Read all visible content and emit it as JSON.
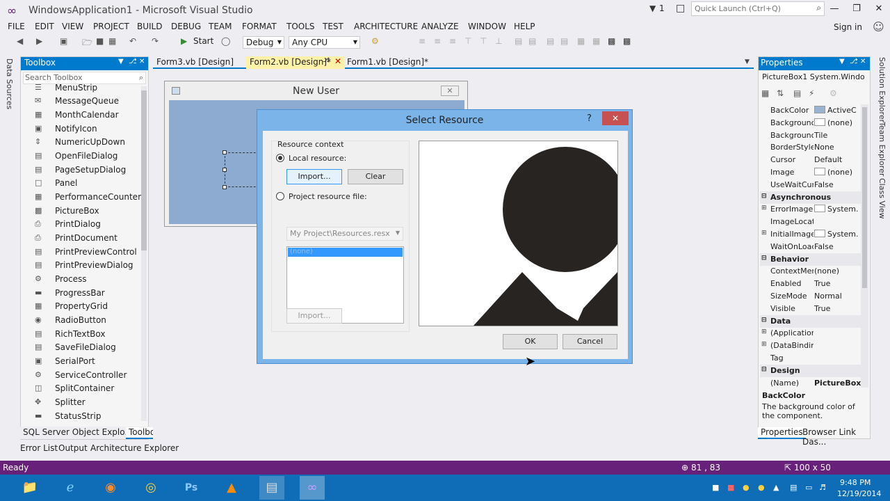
{
  "window": {
    "title": "WindowsApplication1 - Microsoft Visual Studio",
    "notif_count": "1",
    "quick_launch_placeholder": "Quick Launch (Ctrl+Q)",
    "sign_in": "Sign in"
  },
  "menu": [
    "FILE",
    "EDIT",
    "VIEW",
    "PROJECT",
    "BUILD",
    "DEBUG",
    "TEAM",
    "FORMAT",
    "TOOLS",
    "TEST",
    "ARCHITECTURE",
    "ANALYZE",
    "WINDOW",
    "HELP"
  ],
  "toolbar": {
    "start_label": "Start",
    "config": "Debug",
    "platform": "Any CPU"
  },
  "left_vertical_tabs": [
    "Data Sources"
  ],
  "toolbox": {
    "title": "Toolbox",
    "search_placeholder": "Search Toolbox",
    "items": [
      "MenuStrip",
      "MessageQueue",
      "MonthCalendar",
      "NotifyIcon",
      "NumericUpDown",
      "OpenFileDialog",
      "PageSetupDialog",
      "Panel",
      "PerformanceCounter",
      "PictureBox",
      "PrintDialog",
      "PrintDocument",
      "PrintPreviewControl",
      "PrintPreviewDialog",
      "Process",
      "ProgressBar",
      "PropertyGrid",
      "RadioButton",
      "RichTextBox",
      "SaveFileDialog",
      "SerialPort",
      "ServiceController",
      "SplitContainer",
      "Splitter",
      "StatusStrip"
    ],
    "tabs": [
      "SQL Server Object Explo...",
      "Toolbox"
    ]
  },
  "document_tabs": [
    {
      "label": "Form3.vb [Design]",
      "active": false
    },
    {
      "label": "Form2.vb [Design]*",
      "active": true
    },
    {
      "label": "Form1.vb [Design]*",
      "active": false
    }
  ],
  "form": {
    "title": "New User"
  },
  "dialog": {
    "title": "Select Resource",
    "help": "?",
    "resource_context_label": "Resource context",
    "local_resource": "Local resource:",
    "import_btn": "Import...",
    "clear_btn": "Clear",
    "project_resource_file": "Project resource file:",
    "resx_combo": "My Project\\Resources.resx",
    "list_selected": "(none)",
    "import_btn2": "Import...",
    "ok_btn": "OK",
    "cancel_btn": "Cancel"
  },
  "properties": {
    "title": "Properties",
    "object": "PictureBox1  System.Windo",
    "rows": [
      {
        "type": "prop",
        "name": "BackColor",
        "value": "ActiveC",
        "swatch": "#99b4d1"
      },
      {
        "type": "prop",
        "name": "Backgrounc",
        "value": "(none)",
        "swatch": "#ffffff"
      },
      {
        "type": "prop",
        "name": "Backgrounc",
        "value": "Tile"
      },
      {
        "type": "prop",
        "name": "BorderStyle",
        "value": "None"
      },
      {
        "type": "prop",
        "name": "Cursor",
        "value": "Default"
      },
      {
        "type": "prop",
        "name": "Image",
        "value": "(none)",
        "swatch": "#ffffff"
      },
      {
        "type": "prop",
        "name": "UseWaitCur",
        "value": "False"
      },
      {
        "type": "cat",
        "name": "Asynchronous"
      },
      {
        "type": "prop",
        "name": "ErrorImage",
        "value": "System.",
        "expand": true,
        "swatch": "#ffffff"
      },
      {
        "type": "prop",
        "name": "ImageLocat",
        "value": ""
      },
      {
        "type": "prop",
        "name": "InitialImage",
        "value": "System.",
        "expand": true,
        "swatch": "#ffffff"
      },
      {
        "type": "prop",
        "name": "WaitOnLoac",
        "value": "False"
      },
      {
        "type": "cat",
        "name": "Behavior"
      },
      {
        "type": "prop",
        "name": "ContextMer",
        "value": "(none)"
      },
      {
        "type": "prop",
        "name": "Enabled",
        "value": "True"
      },
      {
        "type": "prop",
        "name": "SizeMode",
        "value": "Normal"
      },
      {
        "type": "prop",
        "name": "Visible",
        "value": "True"
      },
      {
        "type": "cat",
        "name": "Data"
      },
      {
        "type": "prop",
        "name": "(Applicatior",
        "value": "",
        "expand": true
      },
      {
        "type": "prop",
        "name": "(DataBindin",
        "value": "",
        "expand": true
      },
      {
        "type": "prop",
        "name": "Tag",
        "value": ""
      },
      {
        "type": "cat",
        "name": "Design"
      },
      {
        "type": "prop",
        "name": "(Name)",
        "value": "PictureBox1",
        "bold": true
      }
    ],
    "desc_title": "BackColor",
    "desc_text": "The background color of the component.",
    "tabs": [
      "Properties",
      "Browser Link Das..."
    ]
  },
  "right_vertical_tabs": [
    "Solution Explorer",
    "Team Explorer",
    "Class View"
  ],
  "bottom_tabs": [
    "Error List",
    "Output",
    "Architecture Explorer"
  ],
  "status": {
    "ready": "Ready",
    "position": "81 , 83",
    "size": "100 x 50"
  },
  "taskbar": {
    "time": "9:48 PM",
    "date": "12/19/2014"
  },
  "colors": {
    "accent": "#007acc",
    "statusbar": "#68217a",
    "form_bg": "#8daad1",
    "dialog_frame": "#7ab4e8"
  }
}
